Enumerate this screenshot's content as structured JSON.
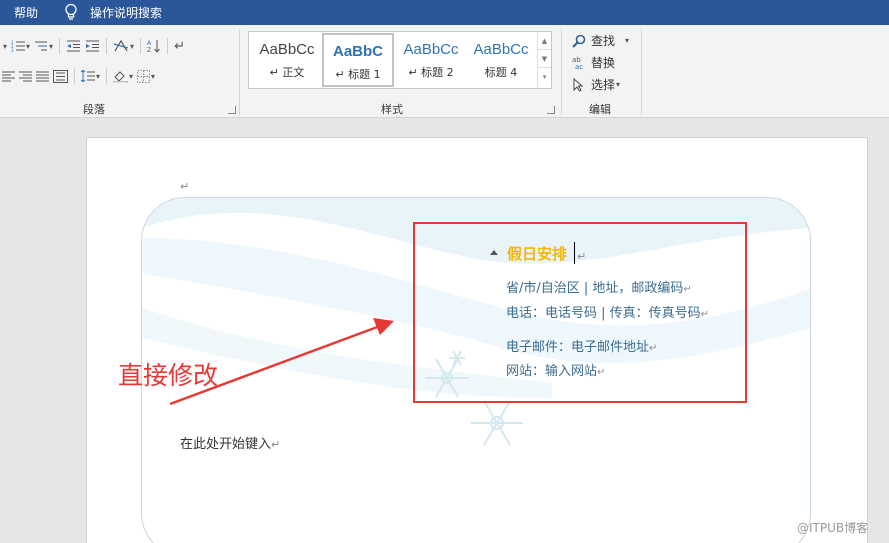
{
  "titlebar": {
    "tab_help": "帮助",
    "search_label": "操作说明搜索"
  },
  "ribbon": {
    "paragraph_group": "段落",
    "styles_group": "样式",
    "editing_group": "编辑",
    "styles": [
      {
        "sample": "AaBbCc",
        "name": "正文",
        "mark": "↵"
      },
      {
        "sample": "AaBbC",
        "name": "标题 1",
        "mark": "↵"
      },
      {
        "sample": "AaBbCc",
        "name": "标题 2",
        "mark": "↵"
      },
      {
        "sample": "AaBbCc",
        "name": "标题 4",
        "mark": ""
      }
    ],
    "find_label": "查找",
    "replace_label": "替换",
    "select_label": "选择"
  },
  "document": {
    "empty_para_mark": "↵",
    "title": "假日安排",
    "address": "省/市/自治区 | 地址，邮政编码",
    "phone": "电话：电话号码 | 传真：传真号码",
    "email": "电子邮件：电子邮件地址",
    "website": "网站：输入网站",
    "para_mark": "↵",
    "body_placeholder": "在此处开始键入",
    "annotation": "直接修改"
  },
  "watermark": "@ITPUB博客",
  "colors": {
    "title_bar": "#2b579a",
    "heading": "#f5b800",
    "contact_text": "#3b6c8f",
    "annotation_red": "#e53935"
  }
}
